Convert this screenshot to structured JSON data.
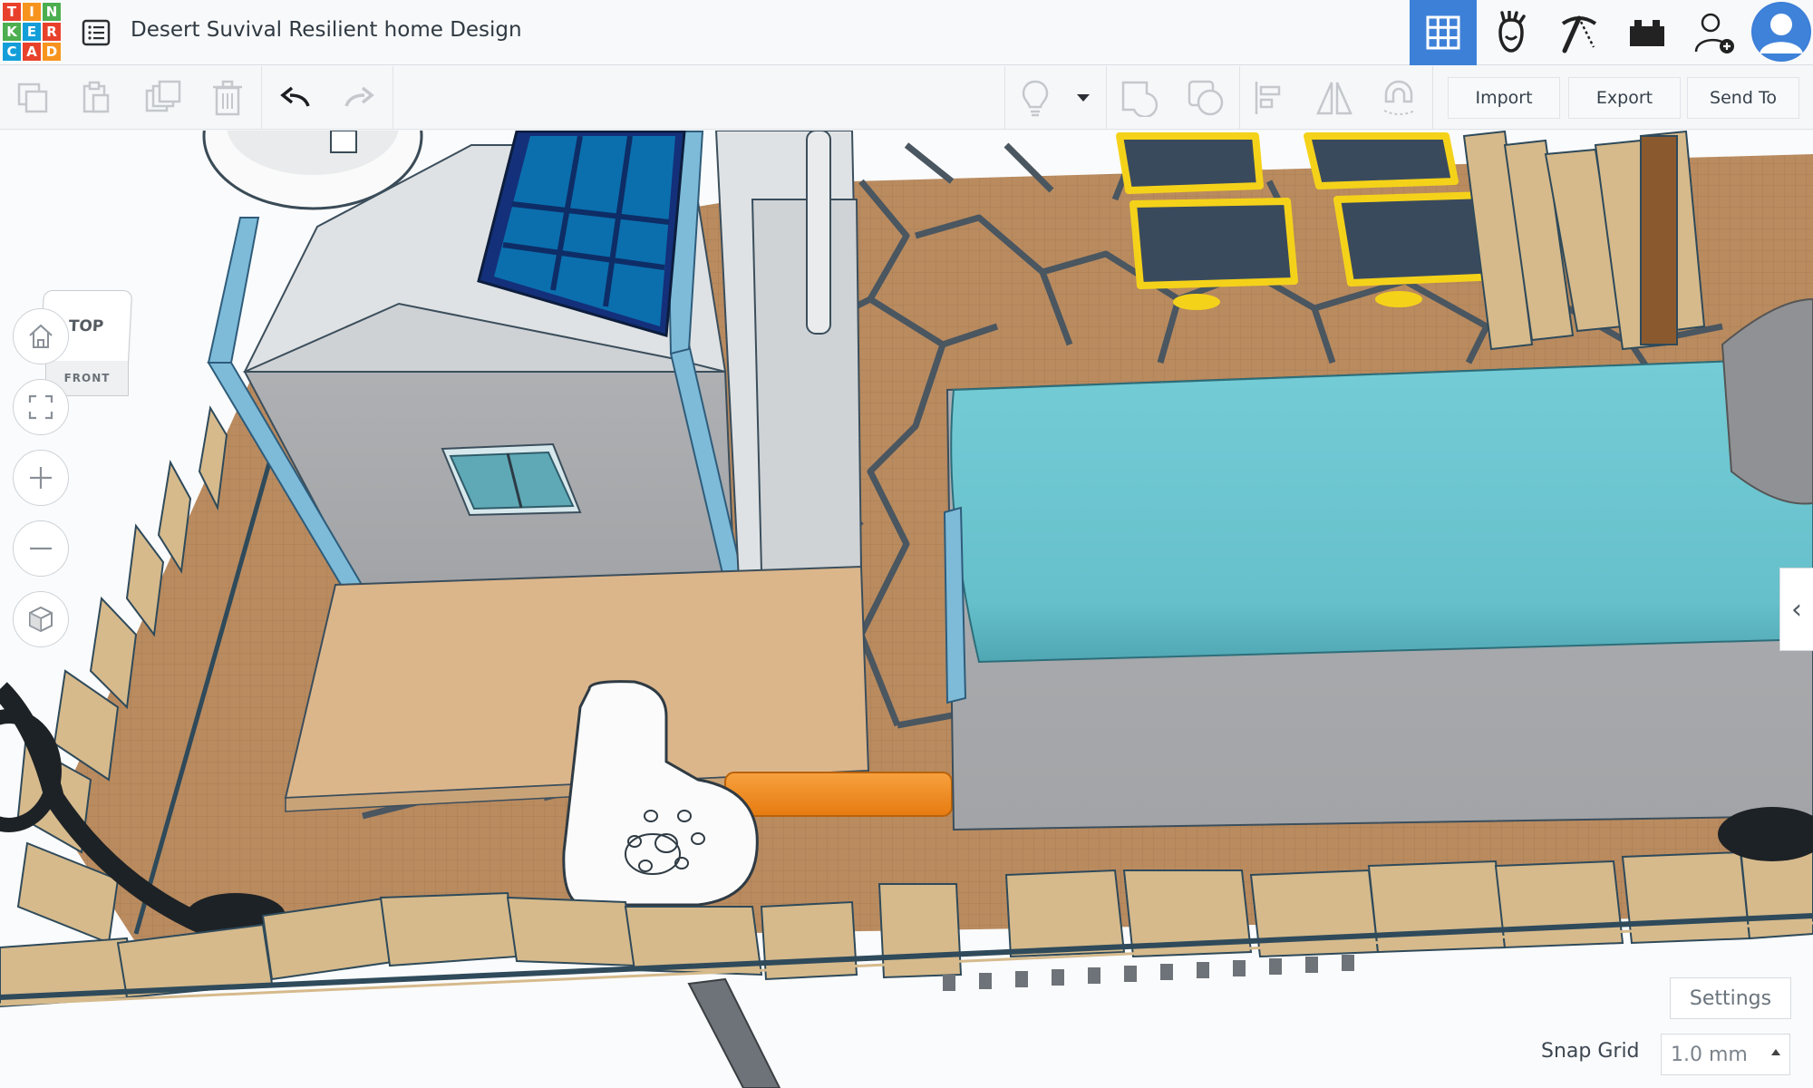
{
  "app": {
    "logo_letters": [
      "T",
      "I",
      "N",
      "K",
      "E",
      "R",
      "C",
      "A",
      "D"
    ],
    "title": "Desert Suvival Resilient home Design"
  },
  "nav": {
    "tabs": [
      {
        "name": "3d-design-grid",
        "icon": "grid-icon",
        "active": true
      },
      {
        "name": "circuits",
        "icon": "circuit-hand-icon",
        "active": false
      },
      {
        "name": "codeblocks",
        "icon": "pickaxe-icon",
        "active": false
      },
      {
        "name": "bricks",
        "icon": "brick-icon",
        "active": false
      },
      {
        "name": "invite",
        "icon": "add-user-icon",
        "active": false
      }
    ]
  },
  "toolbar": {
    "import_label": "Import",
    "export_label": "Export",
    "send_to_label": "Send To"
  },
  "viewcube": {
    "top_label": "TOP",
    "front_label": "FRONT"
  },
  "footer": {
    "settings_label": "Settings",
    "snap_grid_label": "Snap Grid",
    "snap_grid_value": "1.0 mm"
  },
  "colors": {
    "accent": "#3d80d8",
    "ground": "#b98b5f",
    "tent": "#6cc6d1",
    "walls": "#a7a9ac",
    "solar_panel": "#0b6fae",
    "deck": "#dcb68b",
    "pipe": "#f08a1f",
    "panel_frame": "#f5d21a"
  }
}
